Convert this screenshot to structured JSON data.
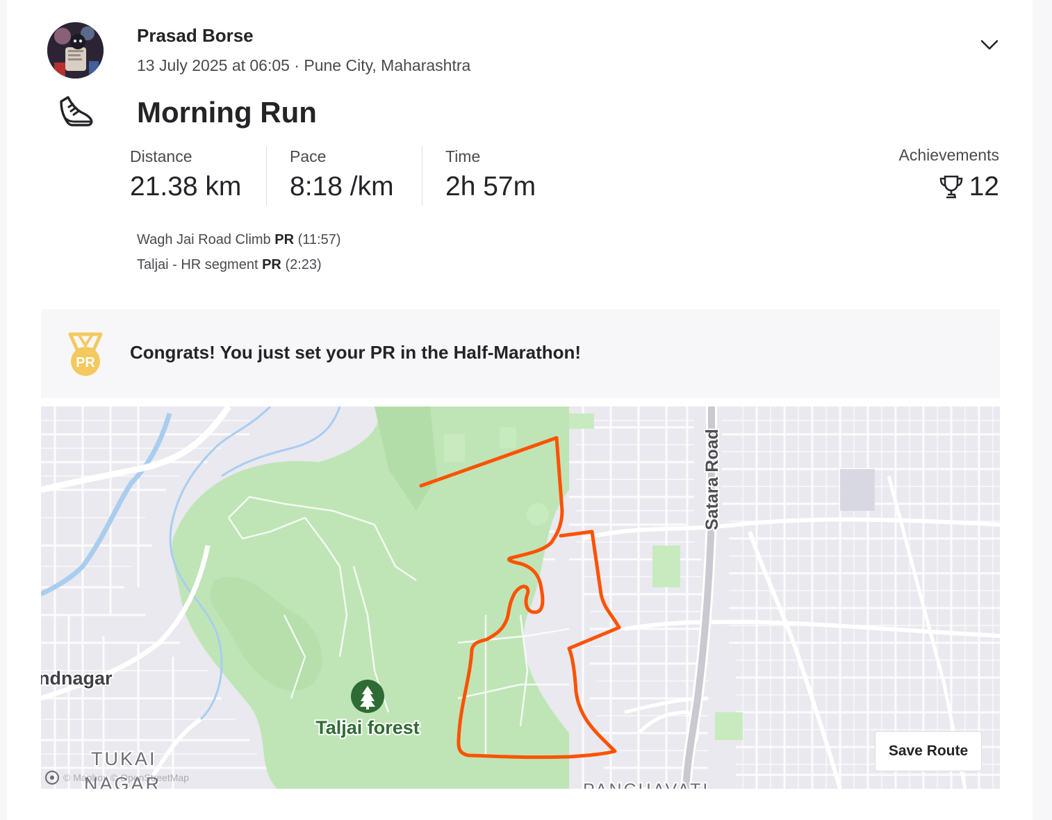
{
  "athlete": {
    "name": "Prasad Borse",
    "meta": "13 July 2025 at 06:05 · Pune City, Maharashtra"
  },
  "activity": {
    "sport_icon": "running-shoe-icon",
    "title": "Morning Run"
  },
  "stats": [
    {
      "label": "Distance",
      "value": "21.38 km"
    },
    {
      "label": "Pace",
      "value": "8:18 /km"
    },
    {
      "label": "Time",
      "value": "2h 57m"
    }
  ],
  "achievements": {
    "label": "Achievements",
    "icon": "trophy-icon",
    "count": "12"
  },
  "segments": [
    {
      "name": "Wagh Jai Road Climb",
      "badge": "PR",
      "time": "(11:57)"
    },
    {
      "name": "Taljai - HR segment",
      "badge": "PR",
      "time": "(2:23)"
    }
  ],
  "pr_banner": {
    "icon": "pr-medal-icon",
    "medal_text": "PR",
    "message": "Congrats! You just set your PR in the Half-Marathon!"
  },
  "map": {
    "labels": {
      "road": "Satara Road",
      "forest": "Taljai forest",
      "locality_left": "ndnagar",
      "locality_tukai_1": "TUKAI",
      "locality_tukai_2": "NAGAR",
      "locality_bottom": "PANCHAVATI"
    },
    "attribution": "© Mapbox © OpenStreetMap",
    "save_route_label": "Save Route",
    "route_color": "#fc5200"
  },
  "colors": {
    "accent": "#fc5200",
    "medal_gold": "#f4c95d",
    "park_green": "#bfe5b6",
    "water_blue": "#a9cdef"
  }
}
